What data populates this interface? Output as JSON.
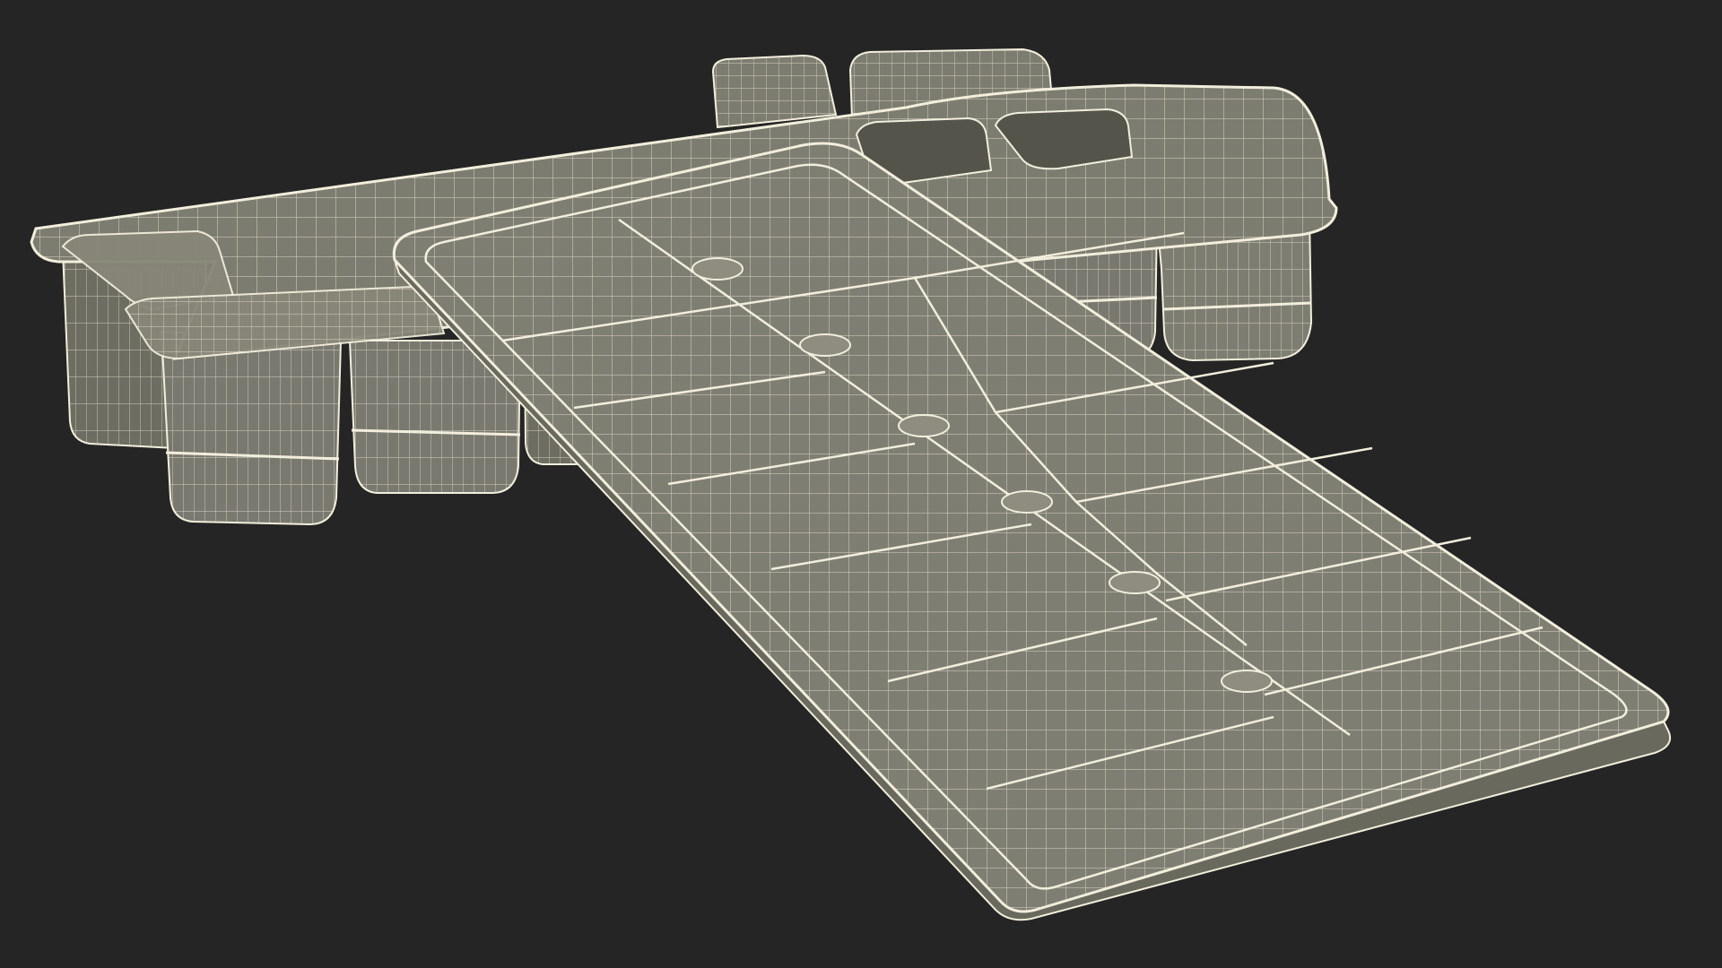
{
  "scene": {
    "background": "#252525",
    "material": "#7d7c70",
    "material_light": "#8e8d80",
    "material_dark": "#5e5d53",
    "wire": "#f2eedc"
  }
}
